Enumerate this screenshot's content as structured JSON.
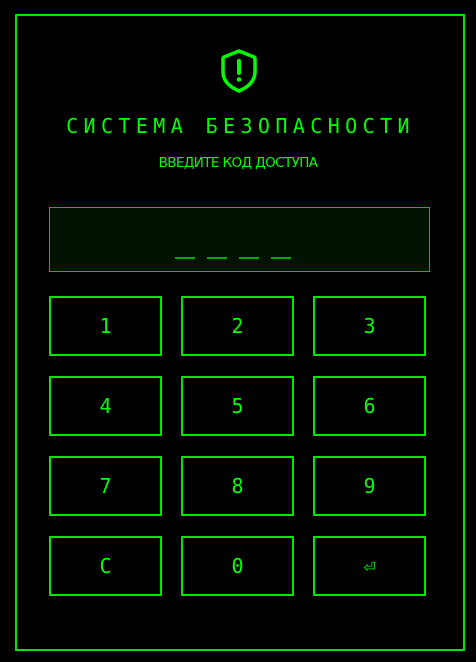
{
  "header": {
    "icon": "shield-alert-icon",
    "title": "СИСТЕМА БЕЗОПАСНОСТИ",
    "subtitle": "ВВЕДИТЕ КОД ДОСТУПА"
  },
  "display": {
    "placeholder_slots": [
      "_",
      "_",
      "_",
      "_"
    ],
    "entered_value": ""
  },
  "keypad": {
    "keys": [
      "1",
      "2",
      "3",
      "4",
      "5",
      "6",
      "7",
      "8",
      "9",
      "C",
      "0",
      "⏎"
    ]
  },
  "colors": {
    "accent": "#00ff00",
    "background": "#000000",
    "display_bg": "#021302"
  }
}
